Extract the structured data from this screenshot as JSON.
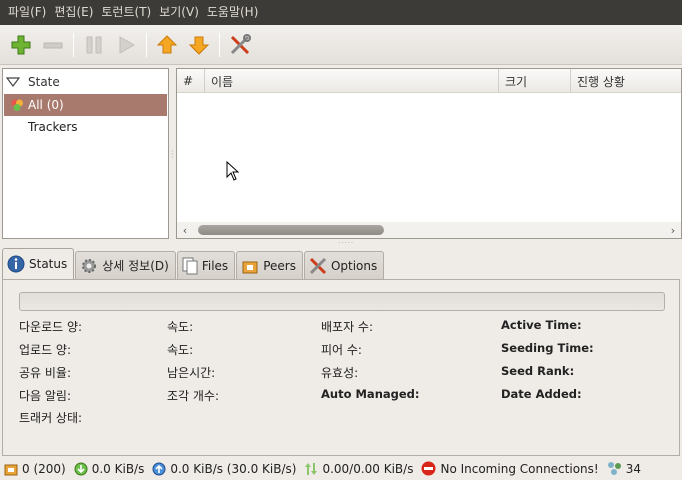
{
  "menu": [
    "파일(F)",
    "편집(E)",
    "토런트(T)",
    "보기(V)",
    "도움말(H)"
  ],
  "sidebar": {
    "header": "State",
    "items": [
      {
        "label": "All (0)",
        "selected": true
      },
      {
        "label": "Trackers",
        "selected": false
      }
    ]
  },
  "list": {
    "columns": [
      "#",
      "이름",
      "크기",
      "진행 상황"
    ]
  },
  "tabs": [
    {
      "label": "Status",
      "icon": "info-icon"
    },
    {
      "label": "상세 정보(D)",
      "icon": "gear-icon"
    },
    {
      "label": "Files",
      "icon": "files-icon"
    },
    {
      "label": "Peers",
      "icon": "peers-icon"
    },
    {
      "label": "Options",
      "icon": "options-icon"
    }
  ],
  "status": {
    "col1": [
      "다운로드 양:",
      "업로드 양:",
      "공유 비율:",
      "다음 알림:",
      "트래커 상태:"
    ],
    "col2": [
      "속도:",
      "속도:",
      "남은시간:",
      "조각 개수:"
    ],
    "col3": [
      "배포자 수:",
      "피어 수:",
      "유효성:",
      "Auto Managed:"
    ],
    "col4": [
      "Active Time:",
      "Seeding Time:",
      "Seed Rank:",
      "Date Added:"
    ]
  },
  "statusbar": {
    "torrents": "0 (200)",
    "download": "0.0 KiB/s",
    "upload": "0.0 KiB/s (30.0 KiB/s)",
    "protocol": "0.00/0.00 KiB/s",
    "connection": "No Incoming Connections!",
    "dht": "34"
  },
  "colors": {
    "menubar": "#3c3b37",
    "selection": "#a87a6d",
    "accent": "#dd4814"
  }
}
